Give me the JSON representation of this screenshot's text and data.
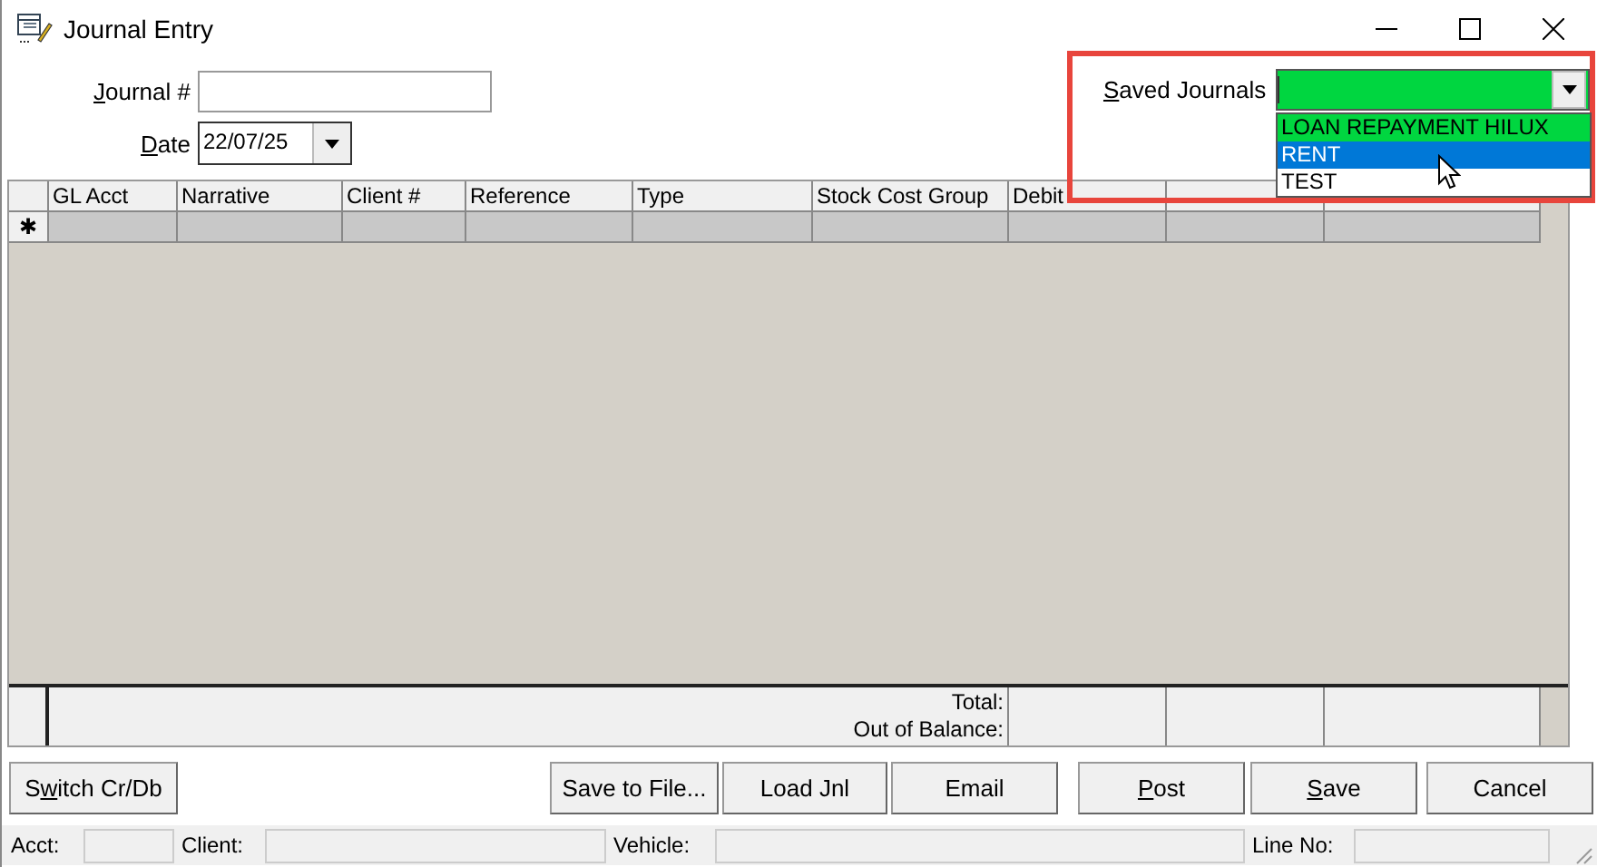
{
  "window": {
    "title": "Journal Entry"
  },
  "form": {
    "journal_label": {
      "key": "J",
      "post": "ournal #"
    },
    "date_label": {
      "key": "D",
      "post": "ate"
    },
    "date_value": "22/07/25"
  },
  "saved_journals": {
    "label": {
      "key": "S",
      "post": "aved Journals"
    },
    "options": [
      {
        "text": "LOAN REPAYMENT HILUX",
        "selected": false,
        "kind": "current"
      },
      {
        "text": "RENT",
        "selected": true,
        "kind": "plain"
      },
      {
        "text": "TEST",
        "selected": false,
        "kind": "plain"
      }
    ]
  },
  "table": {
    "columns": [
      "GL Acct",
      "Narrative",
      "Client #",
      "Reference",
      "Type",
      "Stock Cost Group",
      "Debit"
    ],
    "new_row_marker": "✱"
  },
  "totals": {
    "labels": [
      "Total:",
      "Out of Balance:"
    ]
  },
  "buttons": [
    {
      "pre": "S",
      "key": "w",
      "post": "itch Cr/Db"
    },
    {
      "pre": "Save to File..."
    },
    {
      "pre": "Load Jnl"
    },
    {
      "pre": "Email"
    },
    {
      "key": "P",
      "post": "ost"
    },
    {
      "key": "S",
      "post": "ave"
    },
    {
      "pre": "Cancel"
    }
  ],
  "status_bar": [
    {
      "label": "Acct:"
    },
    {
      "label": "Client:"
    },
    {
      "label": "Vehicle:"
    },
    {
      "label": "Line No:"
    }
  ]
}
